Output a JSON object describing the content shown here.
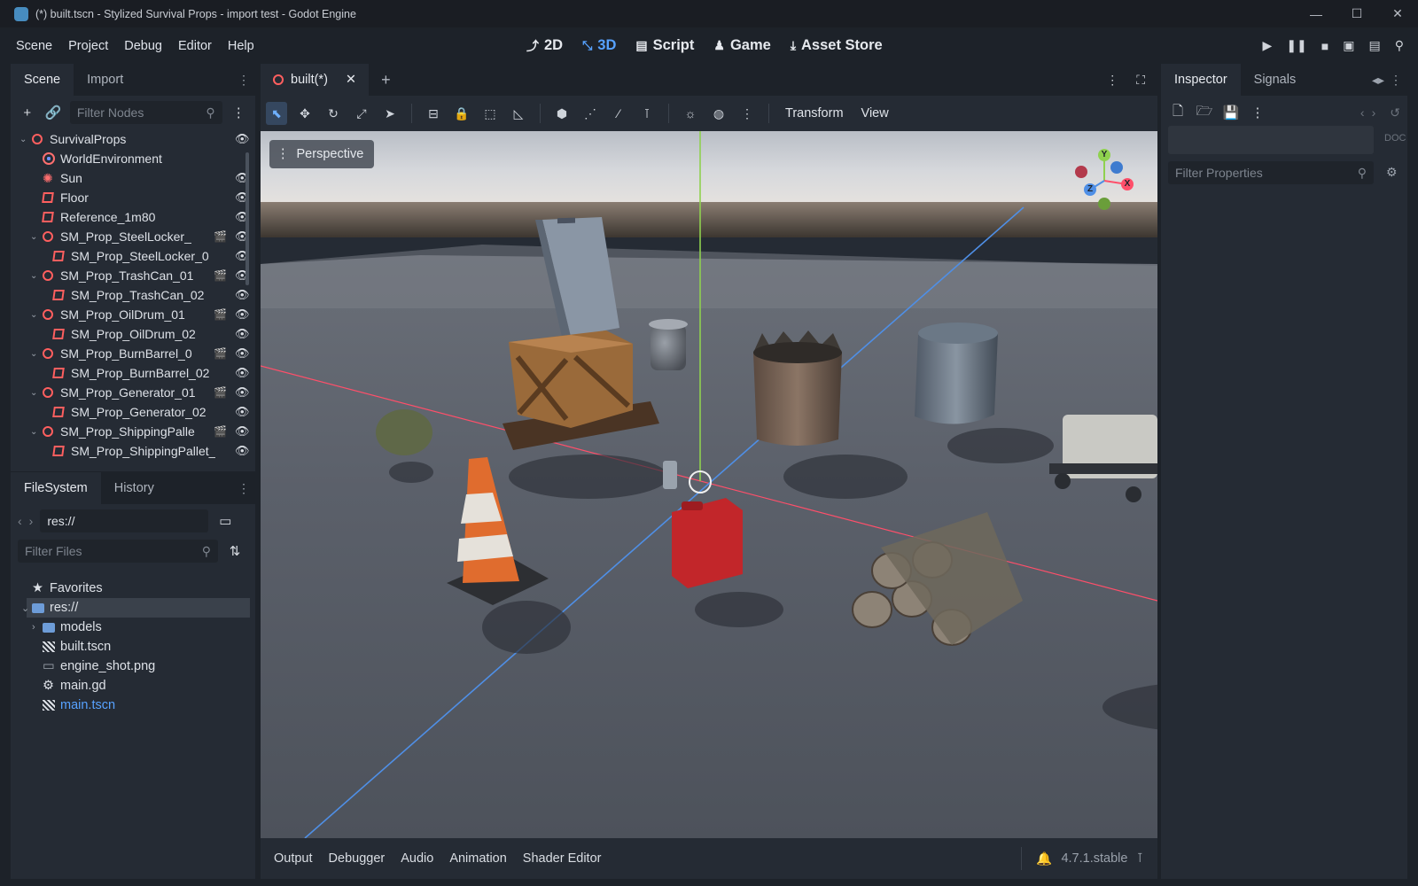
{
  "window": {
    "title": "(*) built.tscn - Stylized Survival Props - import test - Godot Engine"
  },
  "menu": [
    "Scene",
    "Project",
    "Debug",
    "Editor",
    "Help"
  ],
  "workspaces": [
    {
      "label": "2D",
      "icon": "2d-icon"
    },
    {
      "label": "3D",
      "icon": "3d-icon"
    },
    {
      "label": "Script",
      "icon": "script-icon"
    },
    {
      "label": "Game",
      "icon": "game-icon"
    },
    {
      "label": "Asset Store",
      "icon": "asset-store-icon"
    }
  ],
  "scene_dock": {
    "tabs": [
      "Scene",
      "Import"
    ],
    "filter_placeholder": "Filter Nodes",
    "nodes": [
      {
        "label": "SurvivalProps",
        "icon": "node3d",
        "depth": 0,
        "arrow": true,
        "eye": true,
        "scene": false
      },
      {
        "label": "WorldEnvironment",
        "icon": "environment",
        "depth": 1,
        "arrow": false,
        "eye": false,
        "scene": false
      },
      {
        "label": "Sun",
        "icon": "light",
        "depth": 1,
        "arrow": false,
        "eye": true,
        "scene": false
      },
      {
        "label": "Floor",
        "icon": "mesh",
        "depth": 1,
        "arrow": false,
        "eye": true,
        "scene": false
      },
      {
        "label": "Reference_1m80",
        "icon": "mesh",
        "depth": 1,
        "arrow": false,
        "eye": true,
        "scene": false
      },
      {
        "label": "SM_Prop_SteelLocker_",
        "icon": "node3d",
        "depth": 1,
        "arrow": true,
        "eye": true,
        "scene": true
      },
      {
        "label": "SM_Prop_SteelLocker_0",
        "icon": "mesh",
        "depth": 2,
        "arrow": false,
        "eye": true,
        "scene": false
      },
      {
        "label": "SM_Prop_TrashCan_01",
        "icon": "node3d",
        "depth": 1,
        "arrow": true,
        "eye": true,
        "scene": true
      },
      {
        "label": "SM_Prop_TrashCan_02",
        "icon": "mesh",
        "depth": 2,
        "arrow": false,
        "eye": true,
        "scene": false
      },
      {
        "label": "SM_Prop_OilDrum_01",
        "icon": "node3d",
        "depth": 1,
        "arrow": true,
        "eye": true,
        "scene": true
      },
      {
        "label": "SM_Prop_OilDrum_02",
        "icon": "mesh",
        "depth": 2,
        "arrow": false,
        "eye": true,
        "scene": false
      },
      {
        "label": "SM_Prop_BurnBarrel_0",
        "icon": "node3d",
        "depth": 1,
        "arrow": true,
        "eye": true,
        "scene": true
      },
      {
        "label": "SM_Prop_BurnBarrel_02",
        "icon": "mesh",
        "depth": 2,
        "arrow": false,
        "eye": true,
        "scene": false
      },
      {
        "label": "SM_Prop_Generator_01",
        "icon": "node3d",
        "depth": 1,
        "arrow": true,
        "eye": true,
        "scene": true
      },
      {
        "label": "SM_Prop_Generator_02",
        "icon": "mesh",
        "depth": 2,
        "arrow": false,
        "eye": true,
        "scene": false
      },
      {
        "label": "SM_Prop_ShippingPalle",
        "icon": "node3d",
        "depth": 1,
        "arrow": true,
        "eye": true,
        "scene": true
      },
      {
        "label": "SM_Prop_ShippingPallet_",
        "icon": "mesh",
        "depth": 2,
        "arrow": false,
        "eye": true,
        "scene": false
      }
    ]
  },
  "filesystem_dock": {
    "tabs": [
      "FileSystem",
      "History"
    ],
    "path": "res://",
    "filter_placeholder": "Filter Files",
    "items": [
      {
        "label": "Favorites",
        "icon": "star",
        "depth": 0,
        "arrow": false,
        "selected": false,
        "highlight": false
      },
      {
        "label": "res://",
        "icon": "folder",
        "depth": 0,
        "arrow": true,
        "selected": true,
        "highlight": false
      },
      {
        "label": "models",
        "icon": "folder",
        "depth": 1,
        "arrow": true,
        "selected": false,
        "highlight": false
      },
      {
        "label": "built.tscn",
        "icon": "scene",
        "depth": 1,
        "arrow": false,
        "selected": false,
        "highlight": false
      },
      {
        "label": "engine_shot.png",
        "icon": "image",
        "depth": 1,
        "arrow": false,
        "selected": false,
        "highlight": false
      },
      {
        "label": "main.gd",
        "icon": "gear",
        "depth": 1,
        "arrow": false,
        "selected": false,
        "highlight": false
      },
      {
        "label": "main.tscn",
        "icon": "scene",
        "depth": 1,
        "arrow": false,
        "selected": false,
        "highlight": true
      }
    ]
  },
  "editor": {
    "scene_tab": "built(*)",
    "toolbar_menus": [
      "Transform",
      "View"
    ],
    "viewport_label": "Perspective",
    "gizmo_axes": [
      "Y",
      "X",
      "Z"
    ]
  },
  "bottom_panel": {
    "tabs": [
      "Output",
      "Debugger",
      "Audio",
      "Animation",
      "Shader Editor"
    ],
    "version": "4.7.1.stable"
  },
  "inspector": {
    "tabs": [
      "Inspector",
      "Signals"
    ],
    "filter_placeholder": "Filter Properties"
  },
  "colors": {
    "accent": "#57a2ff",
    "node_icon": "#ff5f5f",
    "axis_x": "#ff4f6a",
    "axis_y": "#8fd14f",
    "axis_z": "#4f8fe6"
  }
}
